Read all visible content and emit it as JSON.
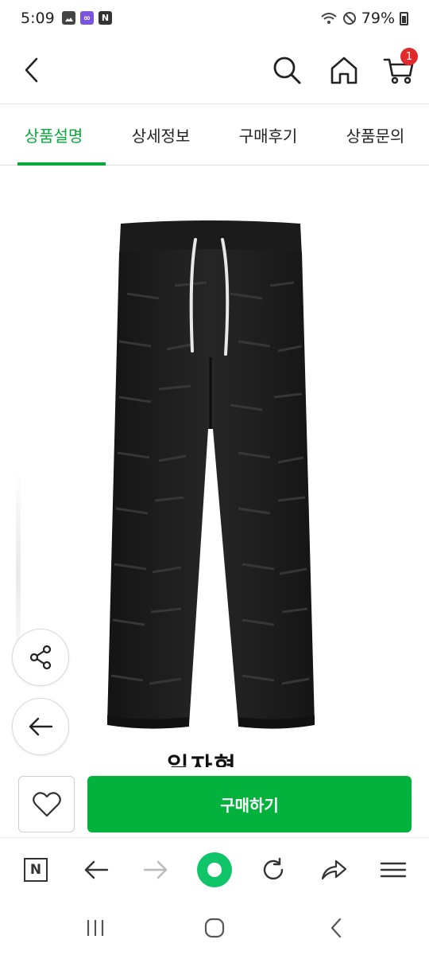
{
  "status_bar": {
    "time": "5:09",
    "battery": "79%",
    "left_icons": [
      "gallery-icon",
      "link-app-icon",
      "naver-app-icon"
    ],
    "right_icons": [
      "wifi-icon",
      "do-not-disturb-icon",
      "battery-icon"
    ]
  },
  "header": {
    "back_icon": "chevron-left-icon",
    "search_icon": "search-icon",
    "home_icon": "home-icon",
    "cart_icon": "cart-icon",
    "cart_count": "1"
  },
  "tabs": [
    {
      "label": "상품설명",
      "active": true
    },
    {
      "label": "상세정보",
      "active": false
    },
    {
      "label": "구매후기",
      "active": false
    },
    {
      "label": "상품문의",
      "active": false
    }
  ],
  "product": {
    "caption": "일자형",
    "color_hex": "#1a1a1a"
  },
  "floating": {
    "share_icon": "share-icon",
    "back_icon": "arrow-left-icon"
  },
  "purchase": {
    "wish_icon": "heart-icon",
    "buy_label": "구매하기",
    "buy_color": "#03b23d"
  },
  "browser_bar": {
    "icons": [
      "naver-n-icon",
      "back-arrow-icon",
      "forward-arrow-icon",
      "green-dot-icon",
      "refresh-icon",
      "share-arrow-icon",
      "menu-icon"
    ]
  },
  "system_nav": {
    "icons": [
      "recent-apps-icon",
      "home-circle-icon",
      "back-chevron-icon"
    ]
  },
  "colors": {
    "accent": "#07a83e",
    "badge": "#e22a2a"
  }
}
